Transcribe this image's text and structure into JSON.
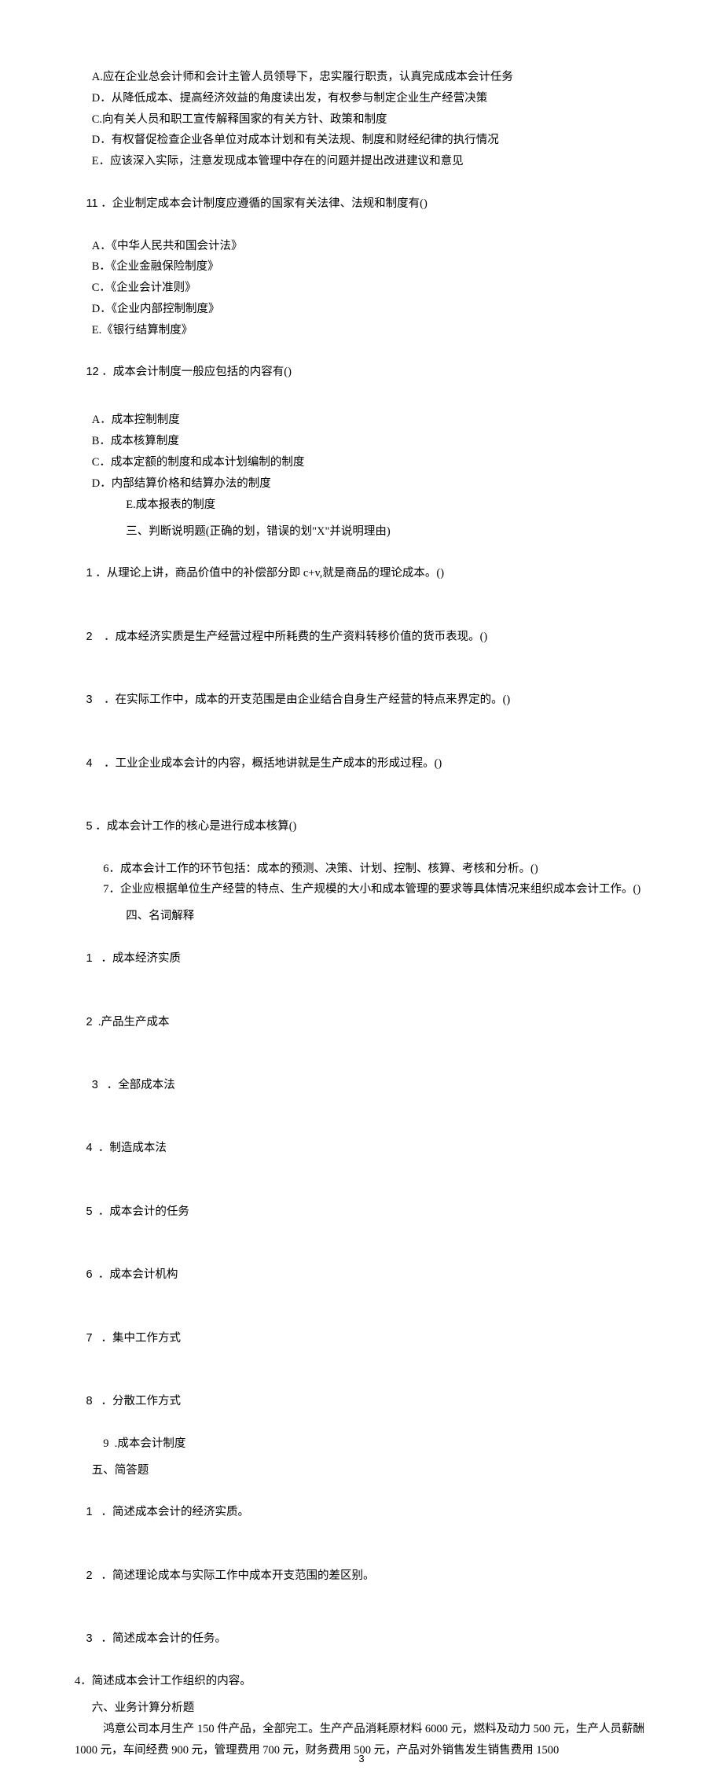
{
  "q10_options": {
    "A": "A.应在企业总会计师和会计主管人员领导下，忠实履行职责，认真完成成本会计任务",
    "D1": "D．从降低成本、提高经济效益的角度读出发，有权参与制定企业生产经营决策",
    "C": "C.向有关人员和职工宣传解释国家的有关方针、政策和制度",
    "D2": "D．有权督促检查企业各单位对成本计划和有关法规、制度和财经纪律的执行情况",
    "E": "E．应该深入实际，注意发现成本管理中存在的问题并提出改进建议和意见"
  },
  "q11": {
    "stem_num": "11",
    "stem_text": " ．企业制定成本会计制度应遵循的国家有关法律、法规和制度有()",
    "A": "A．《中华人民共和国会计法》",
    "B": "B．《企业金融保险制度》",
    "C": "C．《企业会计准则》",
    "D": "D．《企业内部控制制度》",
    "E": "E.《银行结算制度》"
  },
  "q12": {
    "stem_num": "12",
    "stem_text": " ．成本会计制度一般应包括的内容有()",
    "A": "A．成本控制制度",
    "B": "B．成本核算制度",
    "C": "C．成本定额的制度和成本计划编制的制度",
    "D": "D．内部结算价格和结算办法的制度",
    "E": "E.成本报表的制度"
  },
  "section3": {
    "title": "三、判断说明题(正确的划，错误的划\"X\"并说明理由)",
    "i1_num": "1",
    "i1_text": " ．从理论上讲，商品价值中的补偿部分即 c+v,就是商品的理论成本。()",
    "i2_num": "2",
    "i2_text": "    ．成本经济实质是生产经营过程中所耗费的生产资料转移价值的货币表现。()",
    "i3_num": "3",
    "i3_text": "    ．在实际工作中，成本的开支范围是由企业结合自身生产经营的特点来界定的。()",
    "i4_num": "4",
    "i4_text": "    ．工业企业成本会计的内容，概括地讲就是生产成本的形成过程。()",
    "i5_num": "5",
    "i5_text": " ．成本会计工作的核心是进行成本核算()",
    "i6": "6．成本会计工作的环节包括：成本的预测、决策、计划、控制、核算、考核和分析。()",
    "i7": "7．企业应根据单位生产经营的特点、生产规模的大小和成本管理的要求等具体情况来组织成本会计工作。()"
  },
  "section4": {
    "title": "四、名词解释",
    "i1_num": "1",
    "i1_text": "   ．成本经济实质",
    "i2_num": "2",
    "i2_text": "  .产品生产成本",
    "i3_num": "3",
    "i3_text": "   ．全部成本法",
    "i4_num": "4",
    "i4_text": "  ．制造成本法",
    "i5_num": "5",
    "i5_text": "  ．成本会计的任务",
    "i6_num": "6",
    "i6_text": "  ．成本会计机构",
    "i7_num": "7",
    "i7_text": "   ．集中工作方式",
    "i8_num": "8",
    "i8_text": "   ．分散工作方式",
    "i9": "9  .成本会计制度"
  },
  "section5": {
    "title": "五、简答题",
    "i1_num": "1",
    "i1_text": "   ．简述成本会计的经济实质。",
    "i2_num": "2",
    "i2_text": "   ．简述理论成本与实际工作中成本开支范围的差区别。",
    "i3_num": "3",
    "i3_text": "   ．简述成本会计的任务。",
    "i4": "4．简述成本会计工作组织的内容。"
  },
  "section6": {
    "title": "六、业务计算分析题",
    "p1": "鸿意公司本月生产 150 件产品，全部完工。生产产品消耗原材料 6000 元，燃料及动力 500 元，生产人员薪酬 1000 元，车间经费 900 元，管理费用 700 元，财务费用 500 元，产品对外销售发生销售费用 1500"
  },
  "page_number": "3"
}
